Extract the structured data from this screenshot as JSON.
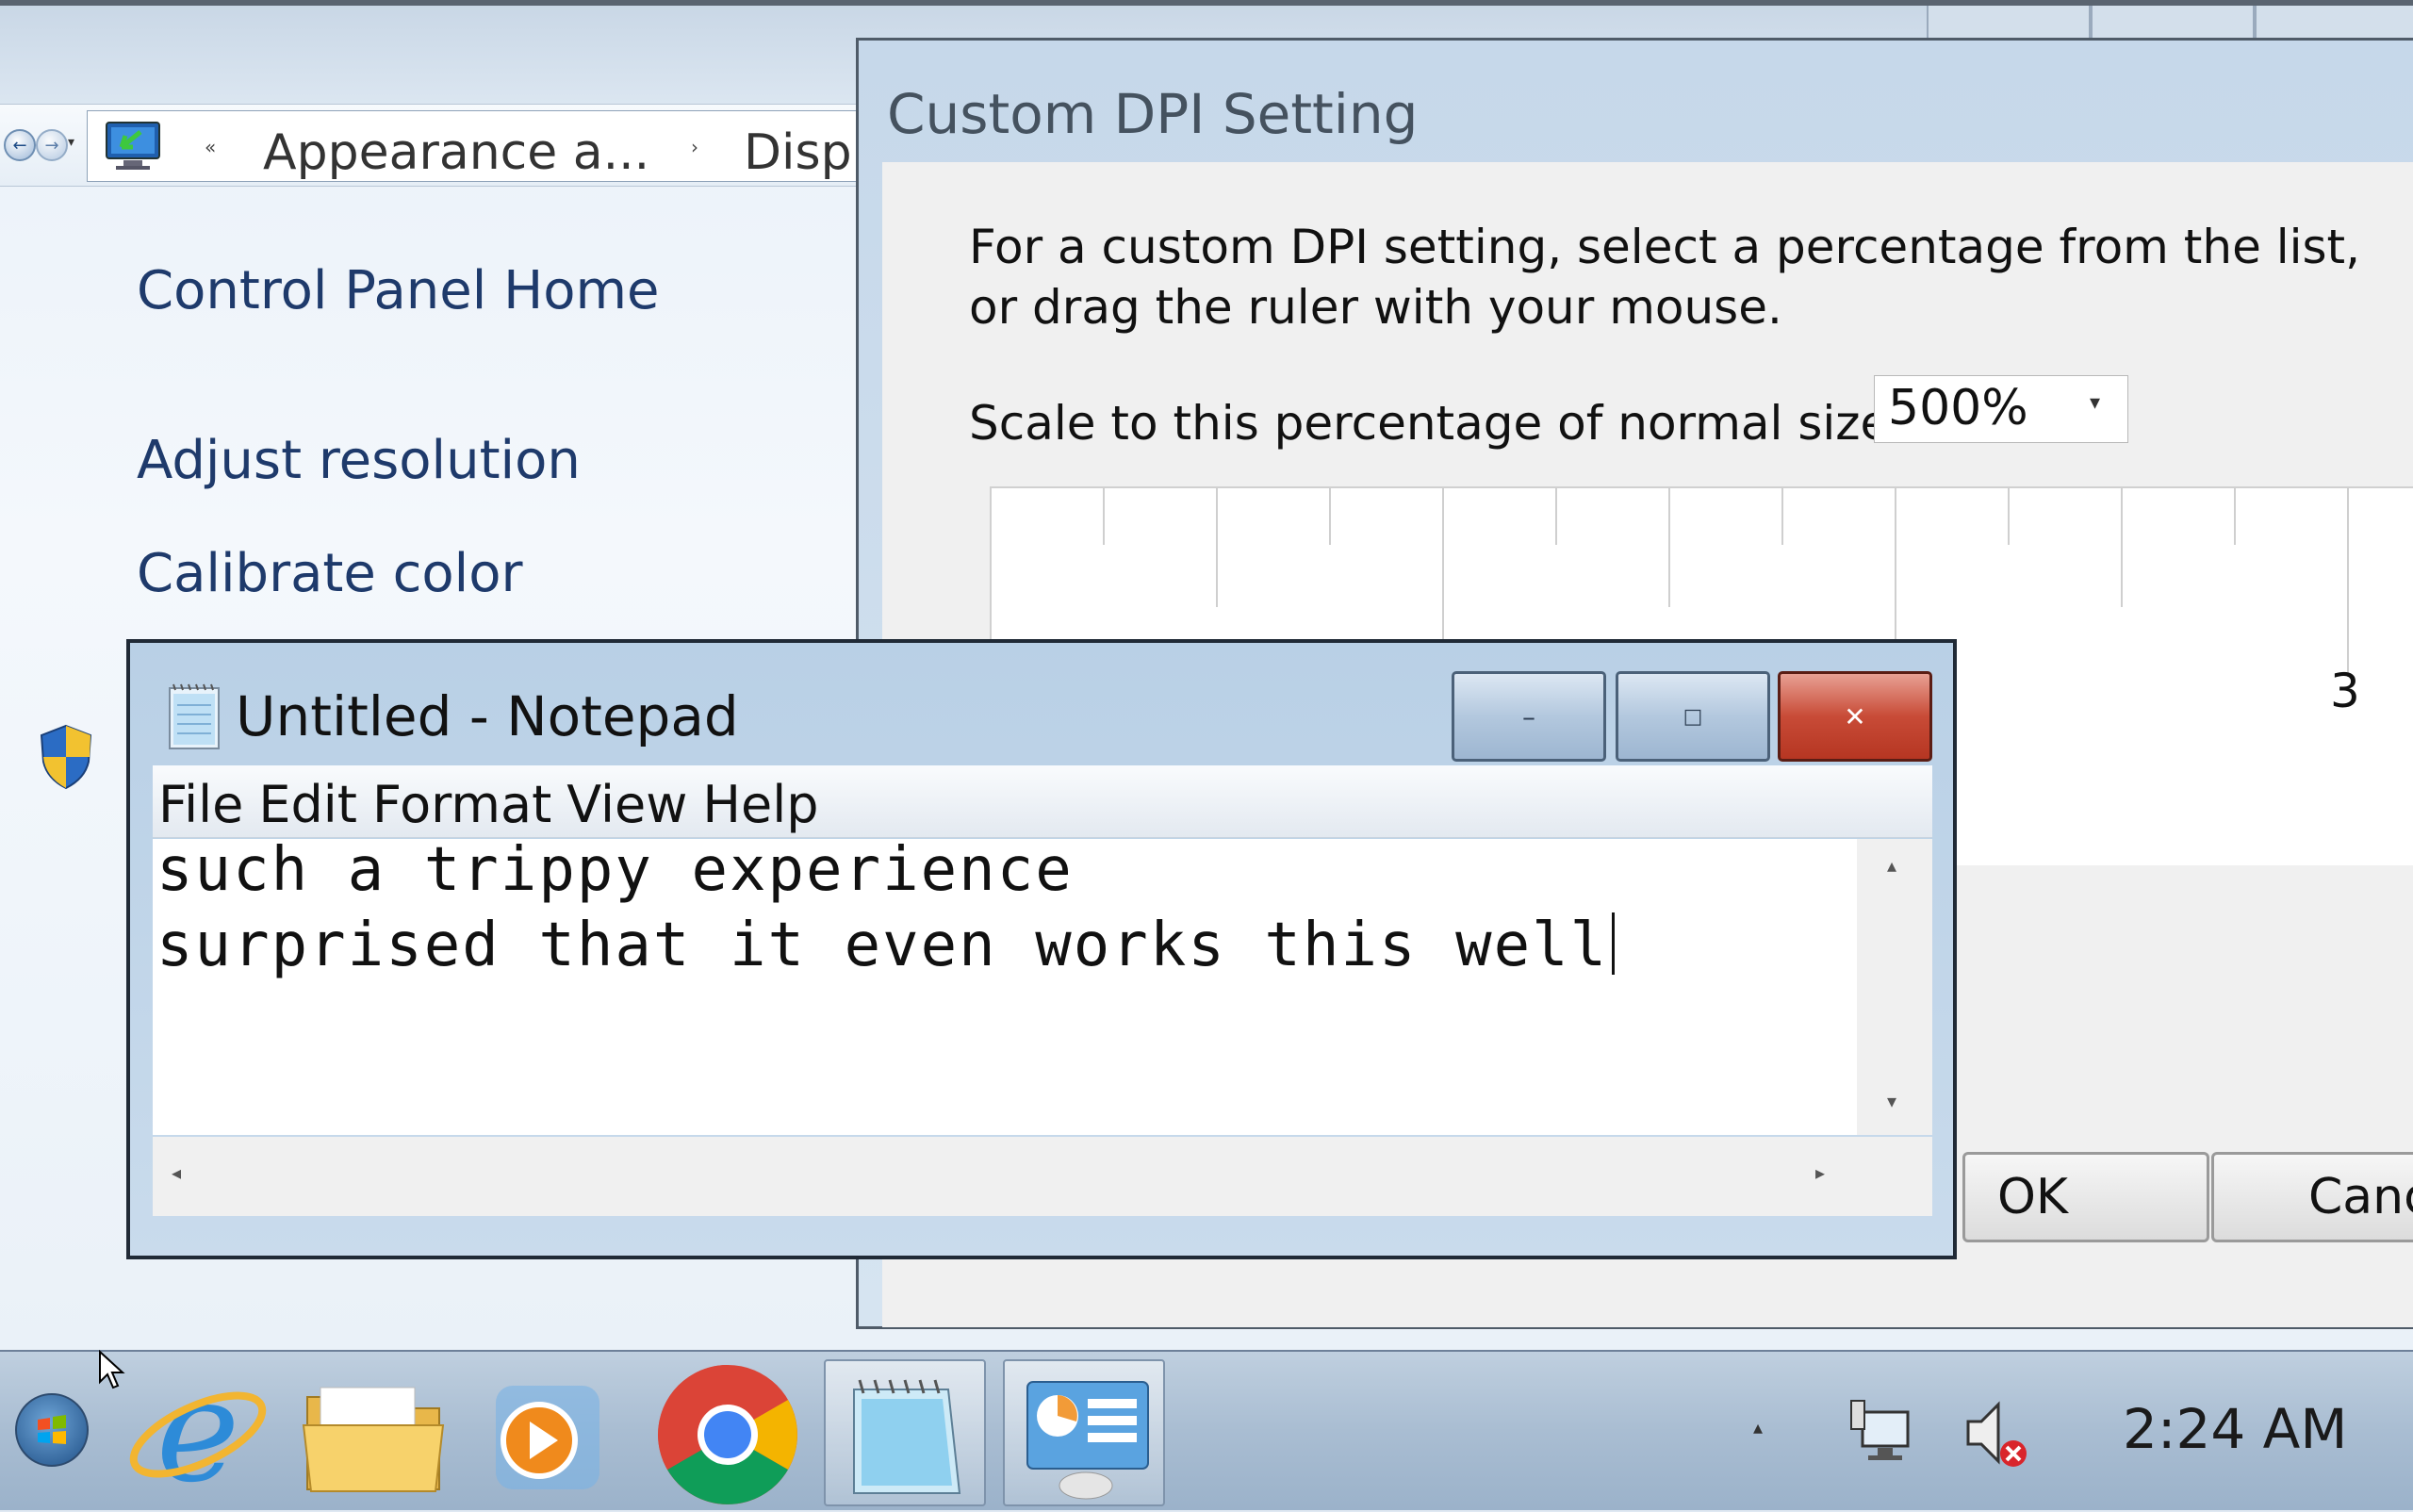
{
  "control_panel": {
    "breadcrumb": {
      "item1": "Appearance a...",
      "item2": "Disp"
    },
    "sidebar": {
      "home": "Control Panel Home",
      "adjust_resolution": "Adjust resolution",
      "calibrate_color": "Calibrate color"
    }
  },
  "dpi_dialog": {
    "title": "Custom DPI Setting",
    "instruction": "For a custom DPI setting, select a percentage from the list, or drag the ruler with your mouse.",
    "scale_label": "Scale to this percentage of normal size:",
    "scale_value": "500%",
    "ruler_number": "3",
    "ok_label": "OK",
    "cancel_label": "Canc"
  },
  "notepad": {
    "title": "Untitled - Notepad",
    "menu": [
      "File",
      "Edit",
      "Format",
      "View",
      "Help"
    ],
    "lines": [
      "such a trippy experience",
      "surprised that it even works this well"
    ]
  },
  "taskbar": {
    "apps": [
      "internet-explorer",
      "windows-explorer",
      "media-player",
      "chrome",
      "notepad",
      "control-panel"
    ],
    "clock": "2:24 AM"
  },
  "colors": {
    "link": "#1e3a6b",
    "close_button": "#c84b37",
    "taskbar": "#a9bdd2"
  }
}
